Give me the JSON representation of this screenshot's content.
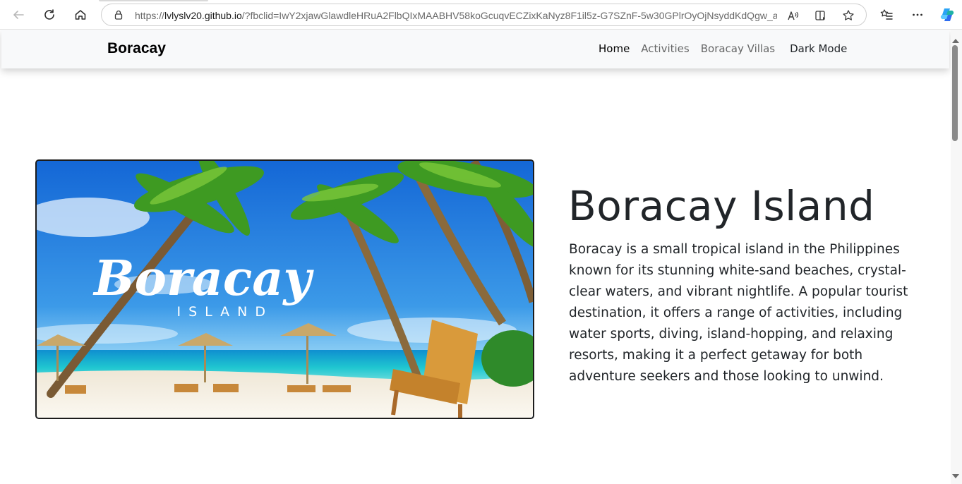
{
  "browser": {
    "url_prefix": "https://",
    "url_host": "lvlyslv20.github.io",
    "url_rest": "/?fbclid=IwY2xjawGlawdleHRuA2FlbQIxMAABHV58koGcuqvECZixKaNyz8F1il5z-G7SZnF-5w30GPlrOyOjNsyddKdQgw_ae...",
    "icons": [
      "back-icon",
      "refresh-icon",
      "home-icon",
      "lock-icon",
      "read-aloud-icon",
      "immersive-reader-icon",
      "favorite-star-icon",
      "favorites-list-icon",
      "more-icon",
      "copilot-icon"
    ]
  },
  "navbar": {
    "brand": "Boracay",
    "links": [
      {
        "label": "Home"
      },
      {
        "label": "Activities"
      },
      {
        "label": "Boracay Villas"
      },
      {
        "label": "Dark Mode"
      }
    ]
  },
  "hero": {
    "image_logo_text": "Boracay",
    "image_logo_subtext": "ISLAND",
    "title": "Boracay Island",
    "description": "Boracay is a small tropical island in the Philippines known for its stunning white-sand beaches, crystal-clear waters, and vibrant nightlife. A popular tourist destination, it offers a range of activities, including water sports, diving, island-hopping, and relaxing resorts, making it a perfect getaway for both adventure seekers and those looking to unwind."
  },
  "colors": {
    "navbar_bg": "#f8f9fa",
    "text": "#212529",
    "sky": "#1e73d8",
    "sea": "#1fc6d0",
    "sand": "#f4eee2"
  }
}
